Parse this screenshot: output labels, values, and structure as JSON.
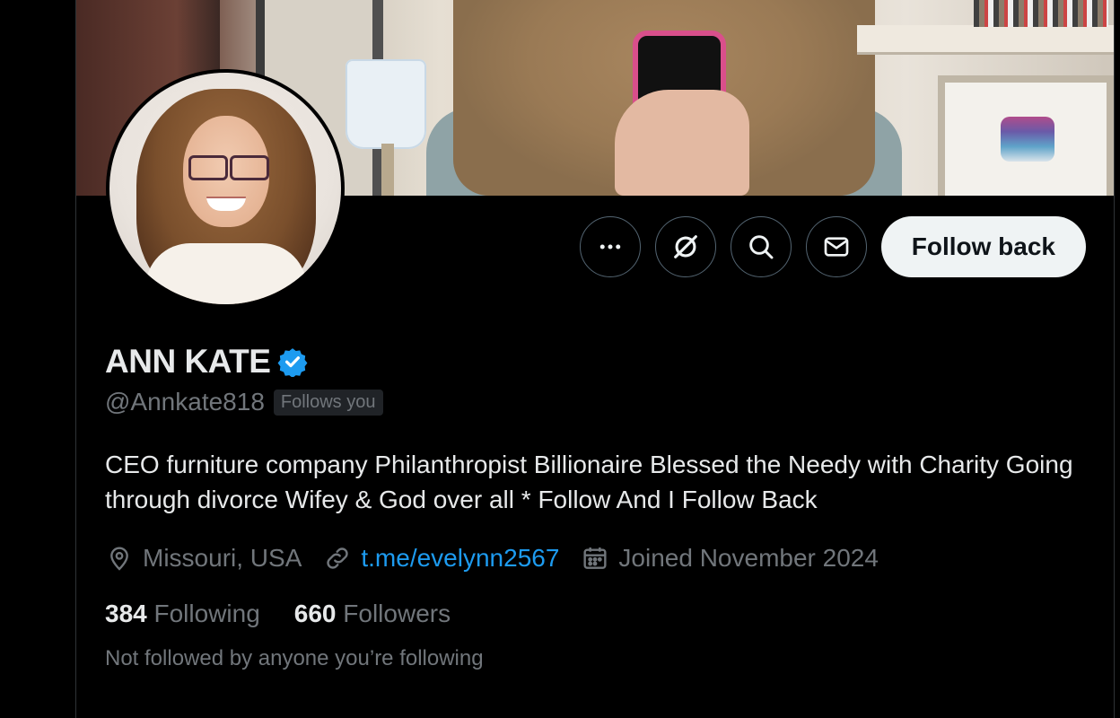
{
  "profile": {
    "display_name": "ANN KATE",
    "verified": true,
    "handle": "@Annkate818",
    "follows_you_label": "Follows you",
    "bio": "CEO furniture company Philanthropist Billionaire Blessed the Needy with Charity Going through divorce Wifey & God over all * Follow And I Follow Back",
    "location": "Missouri, USA",
    "link": "t.me/evelynn2567",
    "joined": "Joined November 2024",
    "following_count": "384",
    "following_label": "Following",
    "followers_count": "660",
    "followers_label": "Followers",
    "mutuals_text": "Not followed by anyone you’re following"
  },
  "actions": {
    "more_icon": "more-icon",
    "grok_icon": "grok-icon",
    "search_icon": "search-icon",
    "message_icon": "message-icon",
    "follow_back_label": "Follow back"
  },
  "colors": {
    "background": "#000000",
    "accent": "#1d9bf0",
    "verified": "#1d9bf0",
    "secondary_text": "#71767b",
    "primary_text": "#e7e9ea",
    "button_bg": "#eff3f4"
  }
}
